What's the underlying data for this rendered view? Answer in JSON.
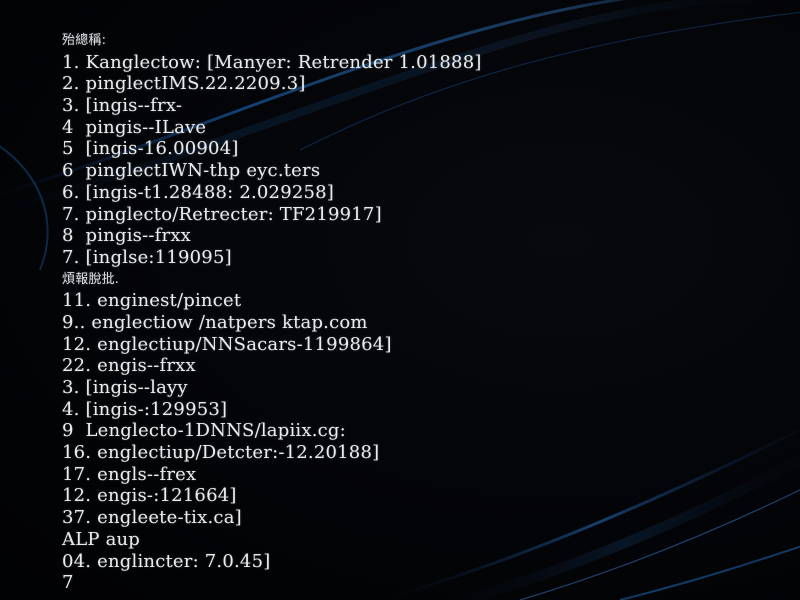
{
  "terminal": {
    "lines": [
      {
        "text": "殆總稱:",
        "kind": "heading"
      },
      {
        "text": "1. Kanglectow: [Manyer: Retrender 1.01888]",
        "kind": "line"
      },
      {
        "text": "2. pinglectIMS.22.2209.3]",
        "kind": "line"
      },
      {
        "text": "3. [ingis--frx-",
        "kind": "line"
      },
      {
        "text": "4  pingis--ILave",
        "kind": "line"
      },
      {
        "text": "5  [ingis-16.00904]",
        "kind": "line"
      },
      {
        "text": "6  pinglectIWN-thp eyc.ters",
        "kind": "line"
      },
      {
        "text": "6. [ingis-t1.28488: 2.029258]",
        "kind": "line"
      },
      {
        "text": "7. pinglecto/Retrecter: TF219917]",
        "kind": "line"
      },
      {
        "text": "8  pingis--frxx",
        "kind": "line"
      },
      {
        "text": "7. [inglse:119095]",
        "kind": "line"
      },
      {
        "text": "煩報脫批.",
        "kind": "heading"
      },
      {
        "text": "11. enginest/pincet",
        "kind": "line"
      },
      {
        "text": "9.. englectiow /natpers ktap.com",
        "kind": "line"
      },
      {
        "text": "12. englectiup/NNSacars-1199864]",
        "kind": "line"
      },
      {
        "text": "22. engis--frxx",
        "kind": "line"
      },
      {
        "text": "3. [ingis--layy",
        "kind": "line"
      },
      {
        "text": "4. [ingis-:129953]",
        "kind": "line"
      },
      {
        "text": "9  Lenglecto-1DNNS/lapiix.cg:",
        "kind": "line"
      },
      {
        "text": "16. englectiup/Detcter:-12.20188]",
        "kind": "line"
      },
      {
        "text": "17. engls--frex",
        "kind": "line"
      },
      {
        "text": "12. engis-:121664]",
        "kind": "line"
      },
      {
        "text": "37. engleete-tix.ca]",
        "kind": "line"
      },
      {
        "text": "ALP aup",
        "kind": "line"
      },
      {
        "text": "04. englincter: 7.0.45]",
        "kind": "line"
      },
      {
        "text": "7",
        "kind": "line"
      }
    ]
  },
  "wallpaper": {
    "accent_color": "#1f6fc4",
    "highlight_color": "#3d93e8",
    "background_color": "#030407"
  }
}
